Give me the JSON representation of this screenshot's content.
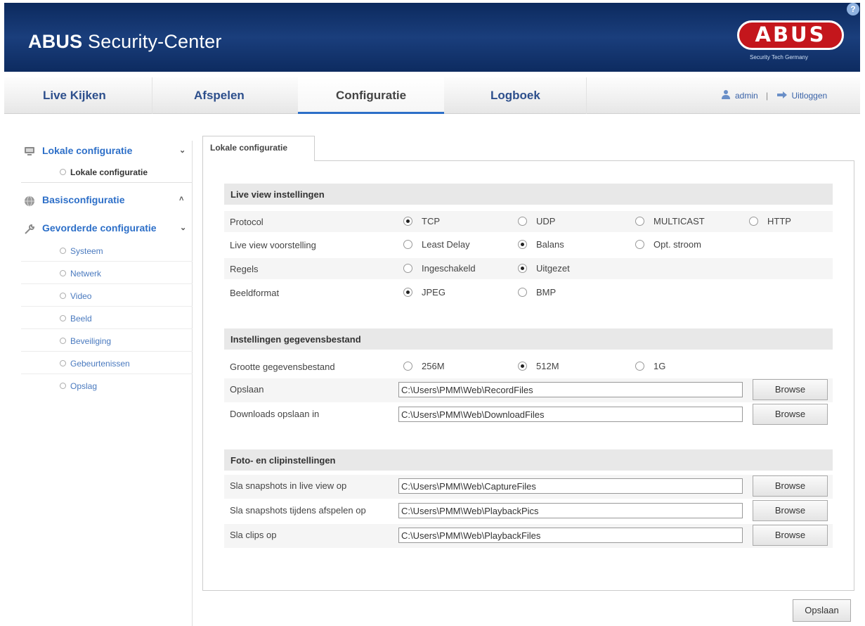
{
  "header": {
    "title_brand": "ABUS",
    "title_rest": "Security-Center",
    "logo_text": "ABUS",
    "logo_tagline": "Security Tech Germany",
    "help_label": "?"
  },
  "nav": {
    "tabs": [
      {
        "label": "Live Kijken",
        "active": false
      },
      {
        "label": "Afspelen",
        "active": false
      },
      {
        "label": "Configuratie",
        "active": true
      },
      {
        "label": "Logboek",
        "active": false
      }
    ],
    "user": "admin",
    "separator": "|",
    "logout": "Uitloggen"
  },
  "sidebar": {
    "sections": [
      {
        "label": "Lokale configuratie",
        "chevron": "⌄",
        "icon": "computer-icon"
      },
      {
        "label": "Basisconfiguratie",
        "chevron": "˄",
        "icon": "globe-icon"
      },
      {
        "label": "Gevorderde configuratie",
        "chevron": "⌄",
        "icon": "wrench-icon"
      }
    ],
    "local_items": [
      "Lokale configuratie"
    ],
    "advanced_items": [
      "Systeem",
      "Netwerk",
      "Video",
      "Beeld",
      "Beveiliging",
      "Gebeurtenissen",
      "Opslag"
    ]
  },
  "content": {
    "tab_label": "Lokale configuratie",
    "live_view": {
      "title": "Live view instellingen",
      "protocol": {
        "label": "Protocol",
        "options": [
          "TCP",
          "UDP",
          "MULTICAST",
          "HTTP"
        ],
        "selected": "TCP"
      },
      "performance": {
        "label": "Live view voorstelling",
        "options": [
          "Least Delay",
          "Balans",
          "Opt. stroom"
        ],
        "selected": "Balans"
      },
      "rules": {
        "label": "Regels",
        "options": [
          "Ingeschakeld",
          "Uitgezet"
        ],
        "selected": "Uitgezet"
      },
      "format": {
        "label": "Beeldformat",
        "options": [
          "JPEG",
          "BMP"
        ],
        "selected": "JPEG"
      }
    },
    "files": {
      "title": "Instellingen gegevensbestand",
      "size": {
        "label": "Grootte gegevensbestand",
        "options": [
          "256M",
          "512M",
          "1G"
        ],
        "selected": "512M"
      },
      "save": {
        "label": "Opslaan",
        "value": "C:\\Users\\PMM\\Web\\RecordFiles"
      },
      "downloads": {
        "label": "Downloads opslaan in",
        "value": "C:\\Users\\PMM\\Web\\DownloadFiles"
      }
    },
    "clips": {
      "title": "Foto- en clipinstellingen",
      "snap_live": {
        "label": "Sla snapshots in live view op",
        "value": "C:\\Users\\PMM\\Web\\CaptureFiles"
      },
      "snap_play": {
        "label": "Sla snapshots tijdens afspelen op",
        "value": "C:\\Users\\PMM\\Web\\PlaybackPics"
      },
      "clips": {
        "label": "Sla clips op",
        "value": "C:\\Users\\PMM\\Web\\PlaybackFiles"
      }
    },
    "browse_label": "Browse",
    "save_button": "Opslaan"
  },
  "colors": {
    "header_bg": "#0c2a5e",
    "accent": "#2d6fc8",
    "logo_red": "#c4161c"
  }
}
